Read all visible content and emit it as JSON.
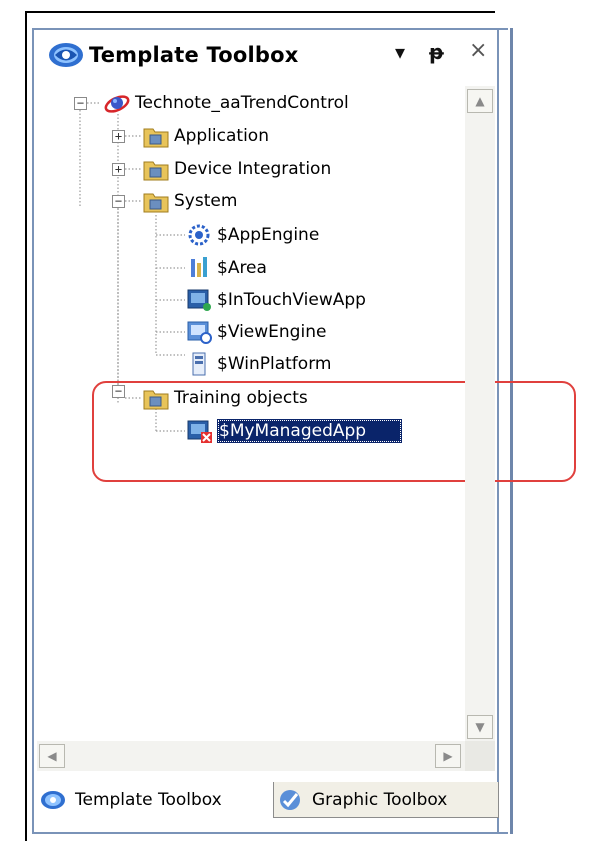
{
  "panel": {
    "title": "Template Toolbox",
    "title_icon": "toolbox-icon",
    "buttons": {
      "dropdown": "▾",
      "pin": "ᵽ",
      "close": "×"
    }
  },
  "tree": {
    "root": {
      "label": "Technote_aaTrendControl",
      "icon": "galaxy-icon",
      "expander": "−"
    },
    "folders": {
      "application": {
        "label": "Application",
        "expander": "+"
      },
      "device_integration": {
        "label": "Device Integration",
        "expander": "+"
      },
      "system": {
        "label": "System",
        "expander": "−"
      },
      "training": {
        "label": "Training objects",
        "expander": "−"
      }
    },
    "system_items": [
      {
        "label": "$AppEngine",
        "icon": "app-engine-icon"
      },
      {
        "label": "$Area",
        "icon": "area-icon"
      },
      {
        "label": "$InTouchViewApp",
        "icon": "intouch-view-app-icon"
      },
      {
        "label": "$ViewEngine",
        "icon": "view-engine-icon"
      },
      {
        "label": "$WinPlatform",
        "icon": "win-platform-icon"
      }
    ],
    "training_items": [
      {
        "label": "$MyManagedApp",
        "icon": "managed-app-icon",
        "selected": true
      }
    ]
  },
  "tabs": [
    {
      "label": "Template Toolbox",
      "active": true
    },
    {
      "label": "Graphic Toolbox",
      "active": false
    }
  ],
  "colors": {
    "selection": "#0a246a",
    "highlight": "#e0403d",
    "panel_border": "#7a93b8"
  }
}
